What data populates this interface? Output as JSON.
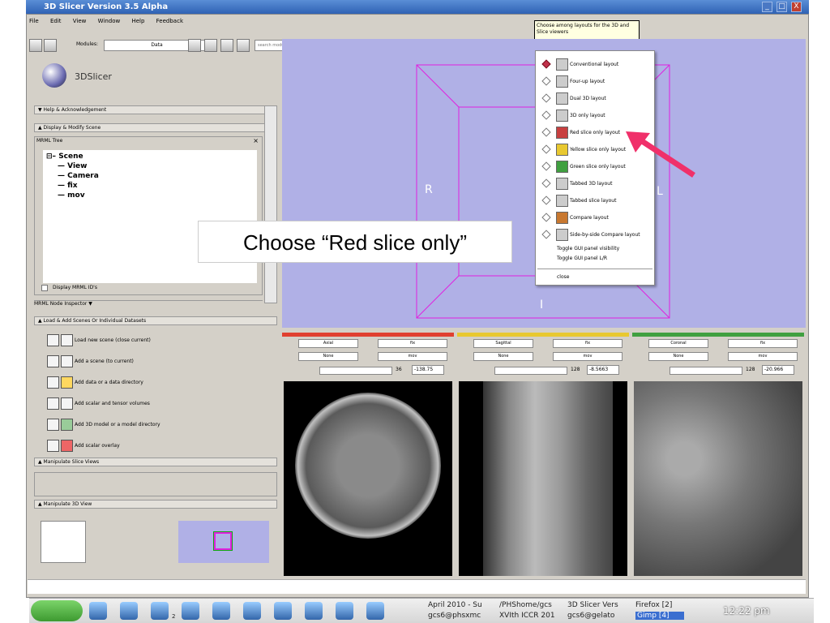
{
  "window": {
    "title": "3D Slicer Version 3.5 Alpha",
    "controls": [
      "_",
      "□",
      "X"
    ]
  },
  "menubar": [
    "File",
    "Edit",
    "View",
    "Window",
    "Help",
    "Feedback"
  ],
  "toolbar": {
    "modules_label": "Modules:",
    "module_value": "Data",
    "search_placeholder": "search modules"
  },
  "tooltip": "Choose among layouts for the 3D and Slice viewers",
  "logo_text": "3DSlicer",
  "left_panel": {
    "sections": {
      "help": "Help & Acknowledgement",
      "display": "Display & Modify Scene",
      "load": "Load & Add Scenes Or Individual Datasets",
      "slice_views": "Manipulate Slice Views",
      "view3d": "Manipulate 3D View"
    },
    "mrml_tree_label": "MRML Tree",
    "tree_items": [
      "Scene",
      "View",
      "Camera",
      "fix",
      "mov"
    ],
    "display_mrml_ids": "Display MRML ID's",
    "node_inspector": "MRML Node Inspector",
    "load_items": [
      "Load new scene (close current)",
      "Add a scene (to current)",
      "Add data or a data directory",
      "Add scalar and tensor volumes",
      "Add 3D model or a model directory",
      "Add scalar overlay"
    ]
  },
  "view3d": {
    "label_r": "R",
    "label_l": "L",
    "label_i": "I",
    "bg_color": "#b0b0e6",
    "box_color": "#e020e0"
  },
  "layout_menu": {
    "items": [
      {
        "label": "Conventional layout",
        "selected": true
      },
      {
        "label": "Four-up layout",
        "selected": false
      },
      {
        "label": "Dual 3D layout",
        "selected": false
      },
      {
        "label": "3D only layout",
        "selected": false
      },
      {
        "label": "Red slice only layout",
        "selected": false
      },
      {
        "label": "Yellow slice only layout",
        "selected": false
      },
      {
        "label": "Green slice only layout",
        "selected": false
      },
      {
        "label": "Tabbed 3D layout",
        "selected": false
      },
      {
        "label": "Tabbed slice layout",
        "selected": false
      },
      {
        "label": "Compare layout",
        "selected": false
      },
      {
        "label": "Side-by-side Compare layout",
        "selected": false
      }
    ],
    "toggles": [
      "Toggle GUI panel visibility",
      "Toggle GUI panel L/R"
    ],
    "close": "close"
  },
  "callout_text": "Choose “Red slice only”",
  "slices": [
    {
      "name": "Axial",
      "color": "#e04030",
      "fg": "fix",
      "bg": "None",
      "label": "mov",
      "offset": "36",
      "value": "-138.75"
    },
    {
      "name": "Sagittal",
      "color": "#e8c830",
      "fg": "fix",
      "bg": "None",
      "label": "mov",
      "offset": "128",
      "value": "-8.5663"
    },
    {
      "name": "Coronal",
      "color": "#40a040",
      "fg": "fix",
      "bg": "None",
      "label": "mov",
      "offset": "128",
      "value": "-20.966"
    }
  ],
  "taskbar": {
    "items": [
      "April 2010 - Su",
      "gcs6@phsxmc",
      "/PHShome/gcs",
      "XVIth ICCR 201",
      "3D Slicer Vers",
      "gcs6@gelato",
      "Firefox [2]",
      "Gimp [4]"
    ],
    "workspace": "2",
    "clock": "12:22 pm"
  },
  "colors": {
    "arrow": "#f0306a",
    "titlebar": "#2f62b4"
  }
}
